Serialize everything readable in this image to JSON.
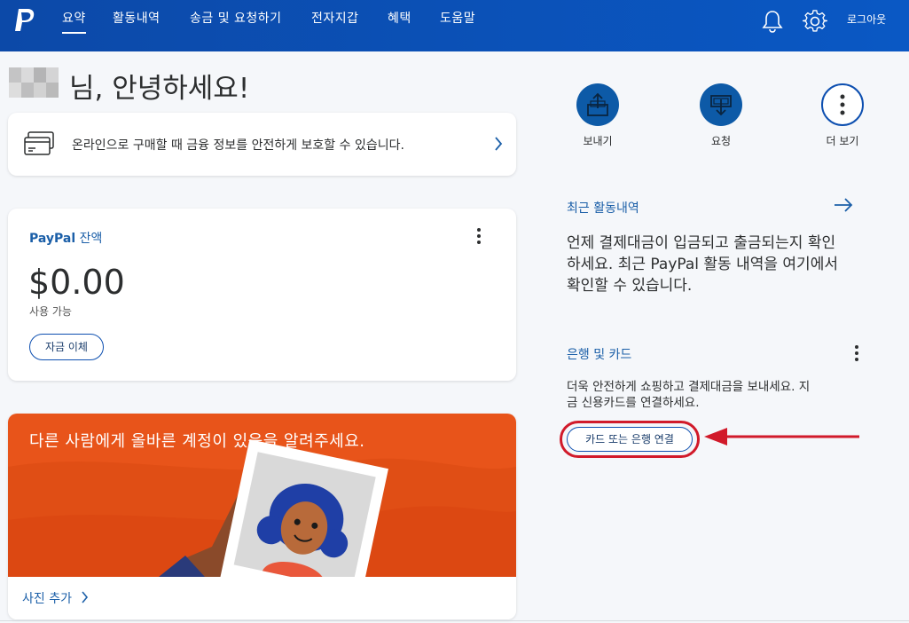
{
  "nav": {
    "items": [
      {
        "label": "요약",
        "active": true
      },
      {
        "label": "활동내역",
        "active": false
      },
      {
        "label": "송금 및 요청하기",
        "active": false
      },
      {
        "label": "전자지갑",
        "active": false
      },
      {
        "label": "혜택",
        "active": false
      },
      {
        "label": "도움말",
        "active": false
      }
    ],
    "logout_label": "로그아웃",
    "icons": [
      "paypal-logo",
      "bell-icon",
      "gear-icon"
    ]
  },
  "greeting": {
    "text": "님, 안녕하세요!"
  },
  "shop_card": {
    "text": "온라인으로 구매할 때 금융 정보를 안전하게 보호할 수 있습니다.",
    "icon": "card-icon"
  },
  "balance_card": {
    "brand": "PayPal",
    "title_suffix": " 잔액",
    "amount": "$0.00",
    "sub": "사용 가능",
    "transfer_label": "자금 이체"
  },
  "promo_card": {
    "title": "다른 사람에게 올바른 계정이 있음을 알려주세요.",
    "link_label": "사진 추가",
    "bg_color": "#e8541a"
  },
  "actions": [
    {
      "label": "보내기",
      "icon": "send-icon"
    },
    {
      "label": "요청",
      "icon": "request-icon"
    },
    {
      "label": "더 보기",
      "icon": "more-icon"
    }
  ],
  "recent": {
    "title": "최근 활동내역",
    "body_line1": "언제 결제대금이 입금되고 출금되는지 확인",
    "body_line2": "하세요. 최근 PayPal 활동 내역을 여기에서",
    "body_line3": "확인할 수 있습니다."
  },
  "bank": {
    "title": "은행 및 카드",
    "body_line1": "더욱 안전하게 쇼핑하고 결제대금을 보내세요. 지",
    "body_line2": "금 신용카드를 연결하세요.",
    "link_label": "카드 또는 은행 연결"
  },
  "colors": {
    "nav_bg": "#0c49a8",
    "link_blue": "#1b5fa8",
    "annotation_red": "#d11a2a"
  }
}
